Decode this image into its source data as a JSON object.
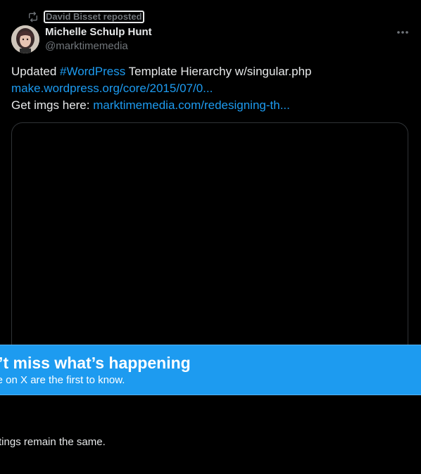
{
  "repost": {
    "icon": "repost-icon",
    "label": "David Bisset reposted"
  },
  "author": {
    "display_name": "Michelle Schulp Hunt",
    "handle": "@marktimemedia",
    "avatar_icon": "avatar"
  },
  "menu": {
    "icon": "more-horizontal-icon"
  },
  "tweet": {
    "line1_prefix": "Updated ",
    "line1_hashtag": "#WordPress",
    "line1_suffix": " Template Hierarchy w/singular.php",
    "line2_link": "make.wordpress.org/core/2015/07/0...",
    "line3_prefix": "Get imgs here: ",
    "line3_link": "marktimemedia.com/redesigning-th..."
  },
  "banner": {
    "title": "n’t miss what’s happening",
    "subtitle": "ple on X are the first to know."
  },
  "footer": {
    "text": "settings remain the same."
  },
  "colors": {
    "background": "#000000",
    "text_primary": "#e7e9ea",
    "text_secondary": "#71767b",
    "accent_link": "#1d9bf0",
    "border": "#2f3336",
    "banner_bg": "#1d9bf0"
  }
}
